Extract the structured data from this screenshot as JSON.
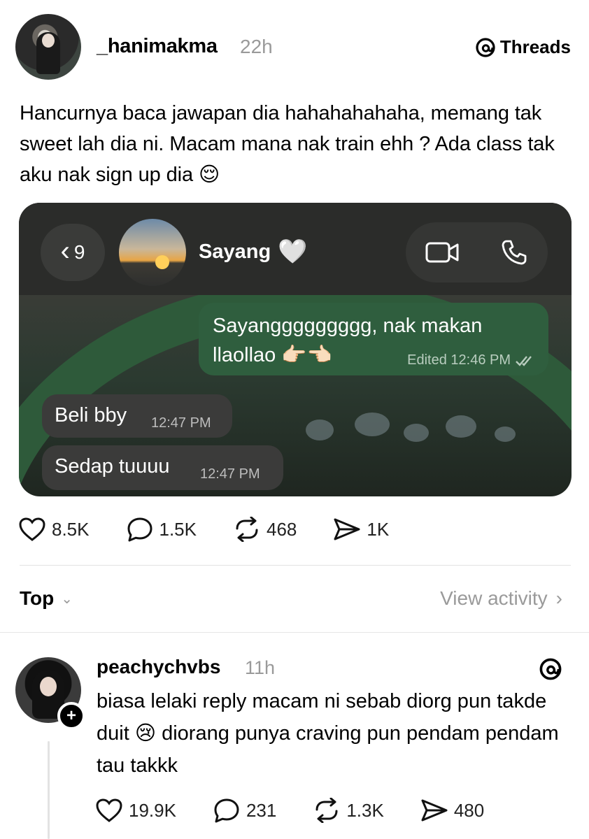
{
  "post": {
    "username": "_hanimakma",
    "time": "22h",
    "app_badge": "Threads",
    "text": "Hancurnya baca jawapan dia hahahahahaha, memang tak sweet lah dia ni. Macam mana nak train ehh ? Ada class tak aku nak sign up dia 😌",
    "likes": "8.5K",
    "comments": "1.5K",
    "reposts": "468",
    "shares": "1K"
  },
  "chat_screenshot": {
    "back_count": "9",
    "contact_name": "Sayang",
    "contact_emoji": "🤍",
    "outgoing": {
      "text": "Sayanggggggggg, nak makan llaollao 👉🏻👈🏻",
      "meta": "Edited 12:46 PM"
    },
    "incoming": [
      {
        "text": "Beli bby",
        "time": "12:47 PM"
      },
      {
        "text": "Sedap tuuuu",
        "time": "12:47 PM"
      }
    ]
  },
  "sort_bar": {
    "label": "Top",
    "view_activity": "View activity"
  },
  "reply": {
    "username": "peachychvbs",
    "time": "11h",
    "text": "biasa lelaki reply macam ni sebab diorg pun takde duit 😢 diorang punya craving pun pendam pendam tau takkk",
    "likes": "19.9K",
    "comments": "231",
    "reposts": "1.3K",
    "shares": "480"
  },
  "icons": {
    "threads": "@",
    "heart": "heart-icon",
    "comment": "comment-icon",
    "repost": "repost-icon",
    "share": "share-icon"
  },
  "colors": {
    "chat_green": "#2f5e3e",
    "muted_gray": "#9a9a9a"
  }
}
